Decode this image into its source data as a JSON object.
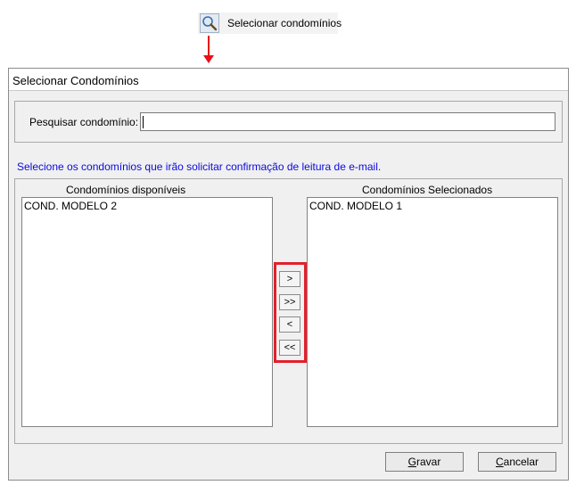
{
  "toolbar": {
    "button_label": "Selecionar condomínios",
    "button_icon": "search-magnifier-icon"
  },
  "annotation": {
    "arrow_color": "#e8101a",
    "highlight_color": "#e3202b"
  },
  "dialog": {
    "title": "Selecionar Condomínios",
    "search": {
      "label": "Pesquisar condomínio:",
      "value": ""
    },
    "hint": "Selecione os condomínios que irão solicitar confirmação de leitura de e-mail.",
    "available": {
      "title": "Condomínios disponíveis",
      "items": [
        "COND. MODELO 2"
      ]
    },
    "selected": {
      "title": "Condomínios Selecionados",
      "items": [
        "COND. MODELO 1"
      ]
    },
    "move_buttons": {
      "add_one": ">",
      "add_all": ">>",
      "remove_one": "<",
      "remove_all": "<<"
    },
    "actions": {
      "save": "Gravar",
      "save_mnemonic": "G",
      "cancel": "Cancelar",
      "cancel_mnemonic": "C"
    }
  }
}
